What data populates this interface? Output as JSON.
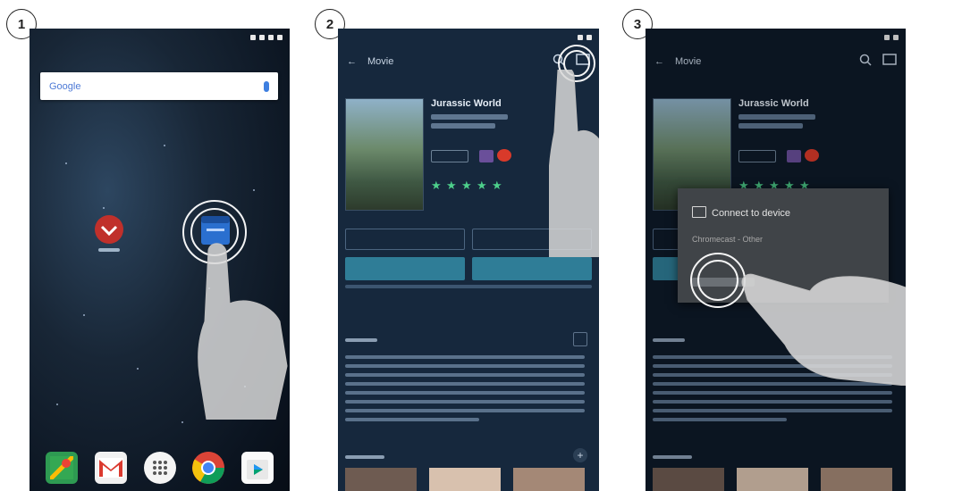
{
  "steps": [
    "1",
    "2",
    "3"
  ],
  "home": {
    "search_brand": "Google",
    "apps": [
      {
        "name": "camera-app",
        "label": ""
      },
      {
        "name": "movie-app",
        "label": ""
      }
    ],
    "dock": [
      "maps-icon",
      "gmail-icon",
      "apps-drawer-icon",
      "chrome-icon",
      "play-store-icon"
    ]
  },
  "movie": {
    "toolbar_title": "Movie",
    "title": "Jurassic World",
    "section_summary": "",
    "section_cast": ""
  },
  "dialog": {
    "title": "Connect to device",
    "subtitle": "Chromecast - Other"
  },
  "colors": {
    "accent": "#2f7d97",
    "star": "#4dcf8b",
    "dialog_bg": "#404448"
  }
}
